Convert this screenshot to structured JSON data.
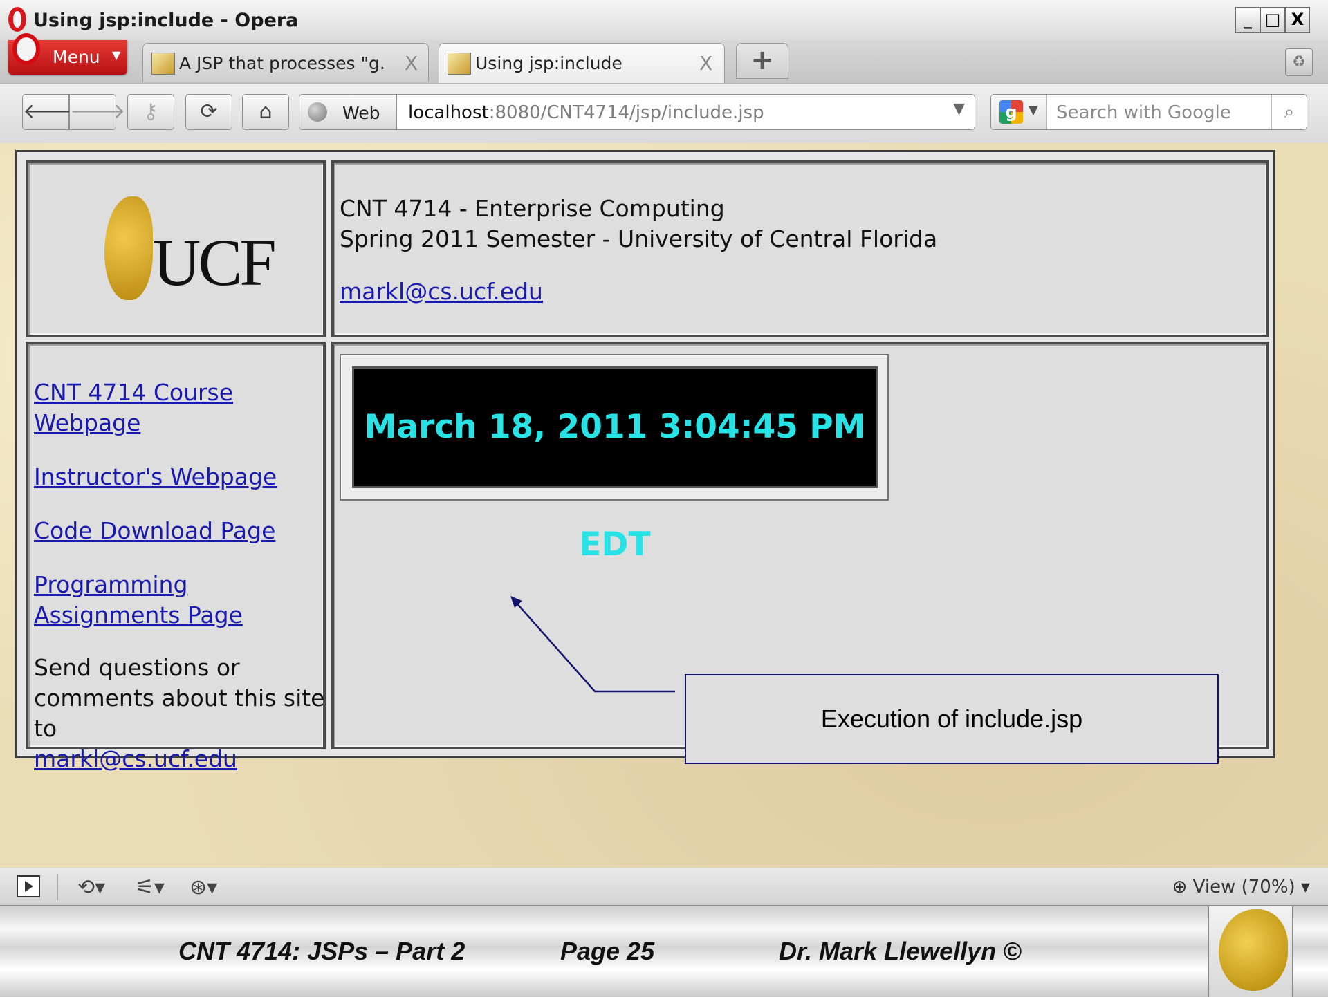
{
  "window": {
    "title": "Using jsp:include - Opera",
    "controls": [
      "_",
      "□",
      "X"
    ]
  },
  "tabbar": {
    "menu_label": "Menu",
    "tabs": [
      {
        "label": "A JSP that processes \"g...",
        "close": "X",
        "active": false
      },
      {
        "label": "Using jsp:include",
        "close": "X",
        "active": true
      }
    ],
    "new_tab": "+"
  },
  "toolbar": {
    "web_label": "Web",
    "address_host": "localhost",
    "address_path": ":8080/CNT4714/jsp/include.jsp",
    "search_placeholder": "Search with Google"
  },
  "page": {
    "logo_text": "UCF",
    "header_line1": "CNT 4714 - Enterprise Computing",
    "header_line2": "Spring 2011 Semester - University of Central Florida",
    "header_email": "markl@cs.ucf.edu",
    "nav_links": [
      "CNT 4714 Course Webpage",
      "Instructor's Webpage",
      "Code Download Page",
      "Programming Assignments Page"
    ],
    "contact_text": "Send questions or comments about this site to",
    "contact_email": "markl@cs.ucf.edu",
    "clock_text": "March 18, 2011 3:04:45 PM EDT",
    "clock_color": "#27e3e6",
    "link_color": "#1a1ab0"
  },
  "callout": {
    "text": "Execution of include.jsp"
  },
  "statusbar": {
    "zoom_label": "View (70%)"
  },
  "footer": {
    "course": "CNT 4714: JSPs – Part 2",
    "page": "Page 25",
    "author": "Dr. Mark Llewellyn ©"
  }
}
